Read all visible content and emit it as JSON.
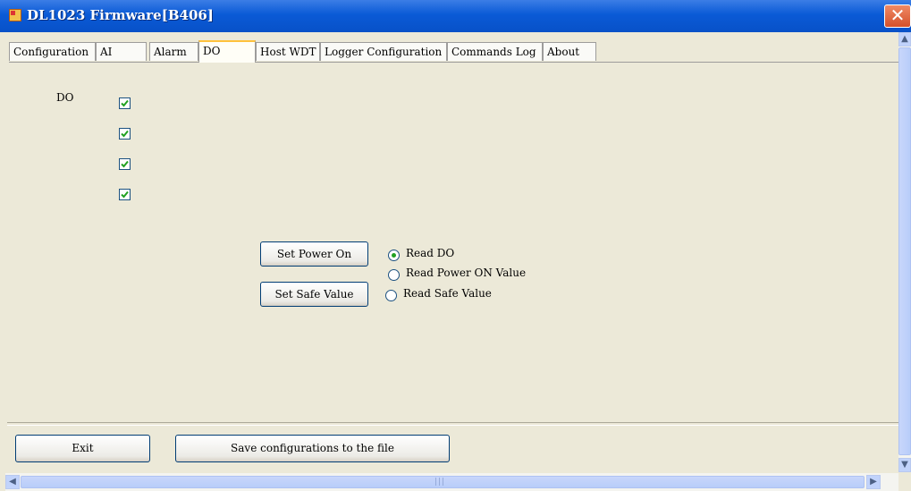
{
  "window": {
    "title": "DL1023 Firmware[B406]",
    "close_glyph": "✕"
  },
  "tabs": [
    {
      "label": "Configuration"
    },
    {
      "label": "AI"
    },
    {
      "label": "Alarm"
    },
    {
      "label": "DO",
      "active": true
    },
    {
      "label": "Host WDT"
    },
    {
      "label": "Logger Configuration"
    },
    {
      "label": "Commands Log"
    },
    {
      "label": "About"
    }
  ],
  "do_panel": {
    "label": "DO",
    "channels": [
      {
        "checked": true
      },
      {
        "checked": true
      },
      {
        "checked": true
      },
      {
        "checked": true
      }
    ],
    "set_power_on_label": "Set Power On",
    "set_safe_value_label": "Set Safe Value",
    "read_options": [
      {
        "label": "Read DO",
        "selected": true
      },
      {
        "label": "Read Power ON Value",
        "selected": false
      },
      {
        "label": "Read Safe Value",
        "selected": false
      }
    ]
  },
  "footer": {
    "exit_label": "Exit",
    "save_label": "Save configurations to the file"
  },
  "icons": {
    "app": "app-icon",
    "close": "close-icon",
    "check": "check-icon",
    "up": "arrow-up-icon",
    "down": "arrow-down-icon",
    "left": "arrow-left-icon",
    "right": "arrow-right-icon",
    "grip": "scroll-grip-icon"
  },
  "colors": {
    "title_bar": "#0a5ad6",
    "close_button": "#d4502b",
    "window_bg": "#ece9d8",
    "active_tab_accent": "#ffc23d",
    "check": "#21a121"
  }
}
